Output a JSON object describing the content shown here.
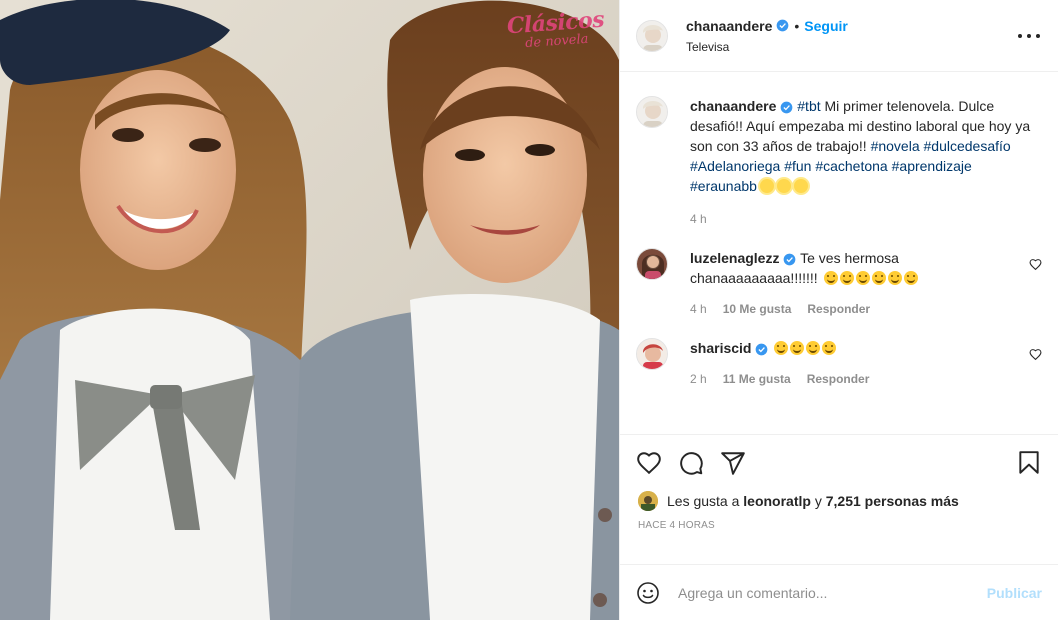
{
  "photo": {
    "watermark_line1": "Clásicos",
    "watermark_line2": "de novela"
  },
  "header": {
    "username": "chanaandere",
    "separator": "•",
    "follow_label": "Seguir",
    "location": "Televisa",
    "more_icon": "more-options-icon"
  },
  "caption": {
    "username": "chanaandere",
    "text_parts": [
      {
        "type": "tag",
        "text": "#tbt"
      },
      {
        "type": "text",
        "text": " Mi primer telenovela. Dulce desafió!! Aquí empezaba mi destino laboral que hoy ya son con 33 años de trabajo!! "
      },
      {
        "type": "tag",
        "text": "#novela"
      },
      {
        "type": "text",
        "text": " "
      },
      {
        "type": "tag",
        "text": "#dulcedesafío"
      },
      {
        "type": "text",
        "text": " "
      },
      {
        "type": "tag",
        "text": "#Adelanoriega"
      },
      {
        "type": "text",
        "text": " "
      },
      {
        "type": "tag",
        "text": "#fun"
      },
      {
        "type": "text",
        "text": " "
      },
      {
        "type": "tag",
        "text": "#cachetona"
      },
      {
        "type": "text",
        "text": " "
      },
      {
        "type": "tag",
        "text": "#aprendizaje"
      },
      {
        "type": "text",
        "text": " "
      },
      {
        "type": "tag",
        "text": "#eraunabb"
      }
    ],
    "emoji_count": 3,
    "time": "4 h"
  },
  "comments": [
    {
      "username": "luzelenaglezz",
      "verified": true,
      "text": "Te ves hermosa chanaaaaaaaaa!!!!!!!",
      "emoji_count": 6,
      "time": "4 h",
      "likes": "10 Me gusta",
      "reply": "Responder"
    },
    {
      "username": "shariscid",
      "verified": true,
      "text": "",
      "emoji_count": 4,
      "time": "2 h",
      "likes": "11 Me gusta",
      "reply": "Responder"
    }
  ],
  "actions": {
    "like_icon": "heart-icon",
    "comment_icon": "comment-icon",
    "share_icon": "share-icon",
    "save_icon": "bookmark-icon"
  },
  "likes": {
    "prefix": "Les gusta a ",
    "user": "leonoratlp",
    "connector": " y ",
    "count": "7,251 personas más"
  },
  "timestamp": "Hace 4 horas",
  "add_comment": {
    "placeholder": "Agrega un comentario...",
    "publish_label": "Publicar"
  },
  "colors": {
    "link_blue": "#0095f6",
    "hashtag": "#00376b",
    "verified_blue": "#3897f0",
    "muted": "#8e8e8e"
  }
}
